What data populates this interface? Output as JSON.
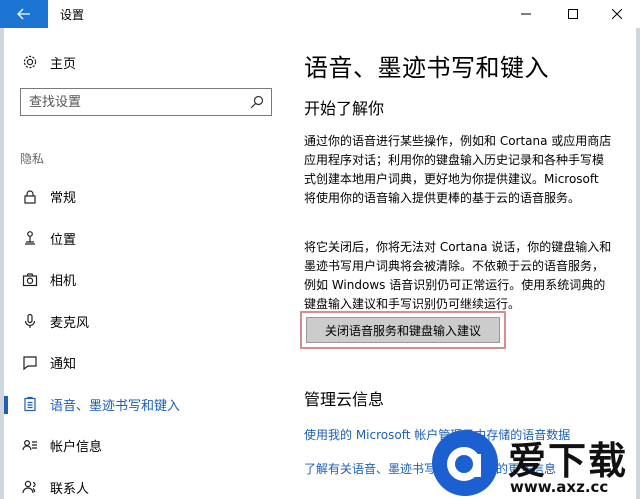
{
  "window": {
    "title": "设置"
  },
  "sidebar": {
    "home_label": "主页",
    "search_placeholder": "查找设置",
    "section_label": "隐私",
    "items": [
      {
        "label": "常规",
        "icon": "lock-icon",
        "active": false
      },
      {
        "label": "位置",
        "icon": "location-icon",
        "active": false
      },
      {
        "label": "相机",
        "icon": "camera-icon",
        "active": false
      },
      {
        "label": "麦克风",
        "icon": "microphone-icon",
        "active": false
      },
      {
        "label": "通知",
        "icon": "notification-icon",
        "active": false
      },
      {
        "label": "语音、墨迹书写和键入",
        "icon": "clipboard-icon",
        "active": true
      },
      {
        "label": "帐户信息",
        "icon": "account-info-icon",
        "active": false
      },
      {
        "label": "联系人",
        "icon": "contacts-icon",
        "active": false
      }
    ]
  },
  "main": {
    "title": "语音、墨迹书写和键入",
    "subtitle": "开始了解你",
    "paragraph1": "通过你的语音进行某些操作，例如和 Cortana 或应用商店应用程序对话；利用你的键盘输入历史记录和各种手写模式创建本地用户词典，更好地为你提供建议。Microsoft 将使用你的语音输入提供更棒的基于云的语音服务。",
    "paragraph2": "将它关闭后，你将无法对 Cortana 说话，你的键盘输入和墨迹书写用户词典将会被清除。不依赖于云的语音服务，例如 Windows 语音识别仍可正常运行。使用系统词典的键盘输入建议和手写识别仍可继续运行。",
    "button_label": "关闭语音服务和键盘输入建议",
    "section2_title": "管理云信息",
    "link1": "使用我的 Microsoft 帐户管理云中存储的语音数据",
    "link2": "了解有关语音、墨迹书写和键入设置的更多信息"
  },
  "watermark": {
    "brand": "爱下载",
    "url": "www.axz.cc"
  },
  "colors": {
    "accent": "#1b5fb8",
    "back_button": "#1b74d1",
    "highlight_frame": "#d98e8e",
    "button_bg": "#cccccc"
  }
}
